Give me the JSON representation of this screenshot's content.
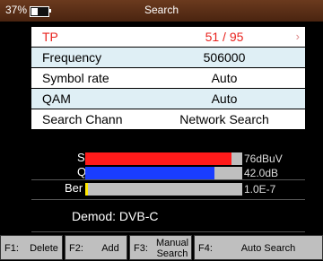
{
  "status": {
    "battery_pct": "37%",
    "battery_level": 0.37
  },
  "header": {
    "title": "Search"
  },
  "rows": [
    {
      "label": "TP",
      "value": "51 / 95",
      "arrow": "›"
    },
    {
      "label": "Frequency",
      "value": "506000"
    },
    {
      "label": "Symbol rate",
      "value": "Auto"
    },
    {
      "label": "QAM",
      "value": "Auto"
    },
    {
      "label": "Search Chann",
      "value": "Network Search"
    }
  ],
  "meters": [
    {
      "label": "S",
      "reading": "76dBuV",
      "level": 0.93,
      "color": "#ff1a1a"
    },
    {
      "label": "Q",
      "reading": "42.0dB",
      "level": 0.82,
      "color": "#1a3dff"
    },
    {
      "label": "Ber",
      "reading": "1.0E-7",
      "level": 0.015,
      "color": "#ffe800"
    }
  ],
  "demod": "Demod: DVB-C",
  "fkeys": [
    {
      "key": "F1:",
      "text": "Delete"
    },
    {
      "key": "F2:",
      "text": "Add"
    },
    {
      "key": "F3:",
      "text": "Manual Search"
    },
    {
      "key": "F4:",
      "text": "Auto Search"
    }
  ]
}
